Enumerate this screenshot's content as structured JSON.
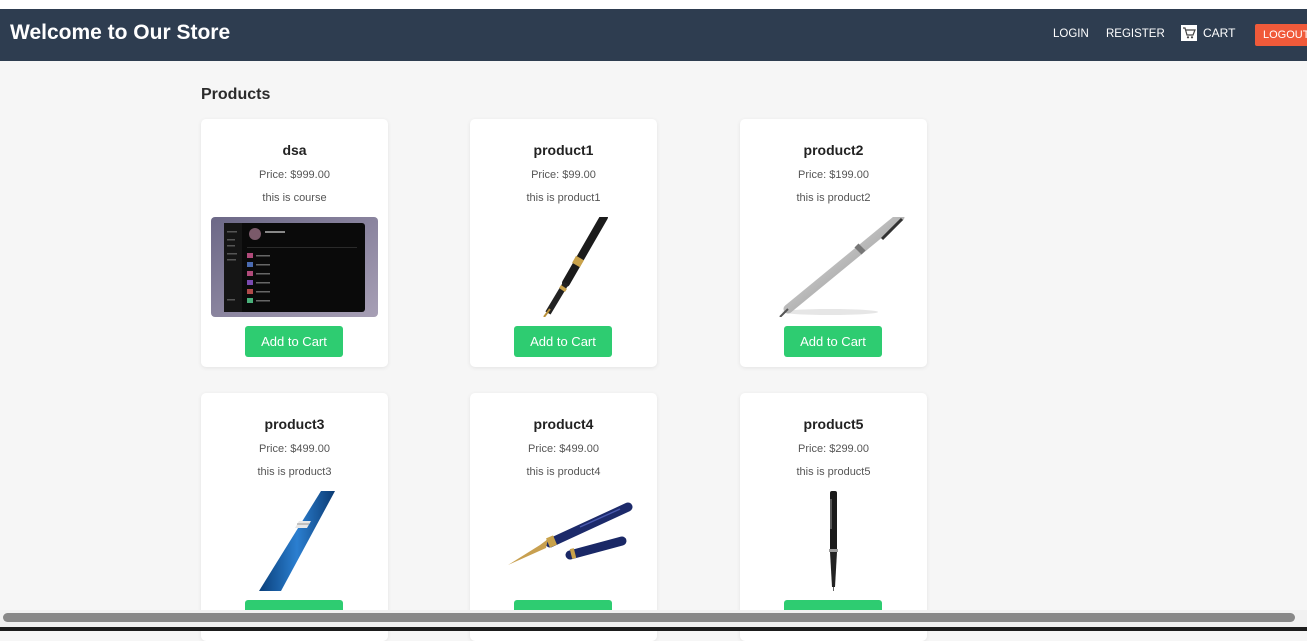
{
  "header": {
    "title": "Welcome to Our Store",
    "nav": {
      "login": "LOGIN",
      "register": "REGISTER",
      "cart": "CART",
      "logout": "LOGOUT"
    }
  },
  "main": {
    "section_title": "Products",
    "add_to_cart_label": "Add to Cart",
    "products": [
      {
        "name": "dsa",
        "price": "Price: $999.00",
        "description": "this is course",
        "image": "app-screenshot"
      },
      {
        "name": "product1",
        "price": "Price: $99.00",
        "description": "this is product1",
        "image": "black-fountain-pen"
      },
      {
        "name": "product2",
        "price": "Price: $199.00",
        "description": "this is product2",
        "image": "silver-ballpoint-pen"
      },
      {
        "name": "product3",
        "price": "Price: $499.00",
        "description": "this is product3",
        "image": "blue-pen-closeup"
      },
      {
        "name": "product4",
        "price": "Price: $499.00",
        "description": "this is product4",
        "image": "blue-fountain-pen-with-cap"
      },
      {
        "name": "product5",
        "price": "Price: $299.00",
        "description": "this is product5",
        "image": "black-slim-pen"
      }
    ]
  },
  "colors": {
    "navbar": "#2e3d50",
    "add_to_cart": "#2ecc71",
    "logout": "#f05a3a",
    "page_background": "#f6f6f6"
  }
}
